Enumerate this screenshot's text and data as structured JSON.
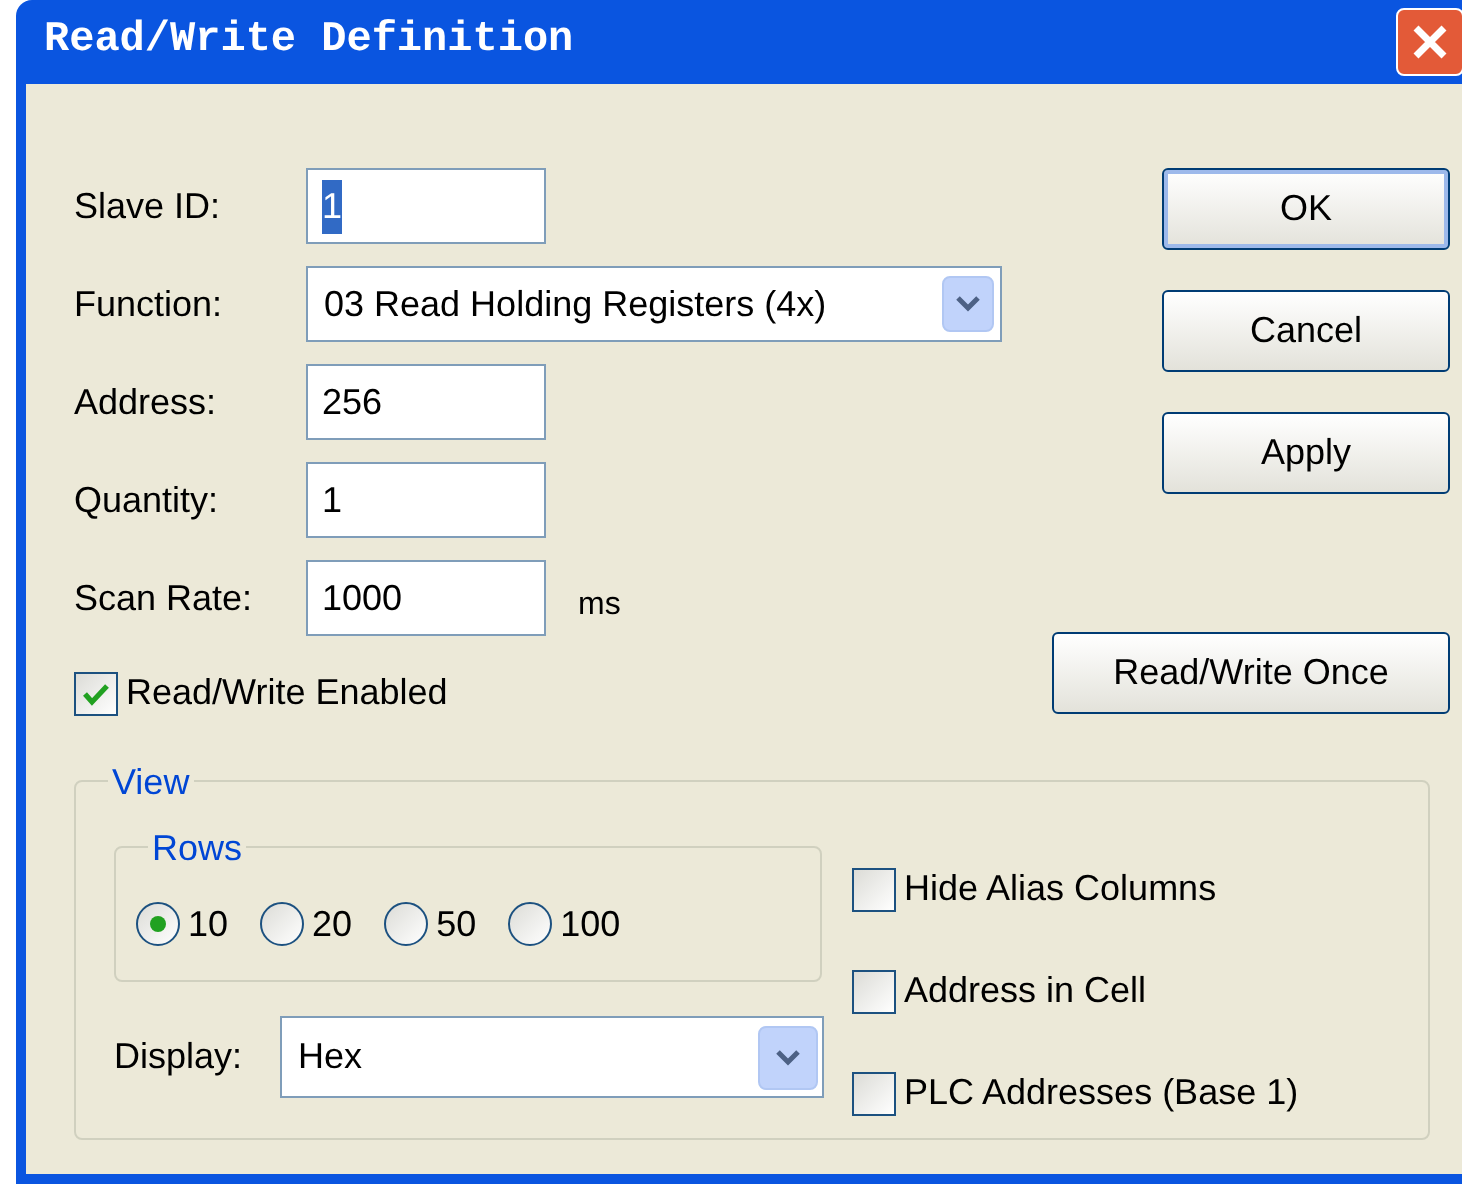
{
  "window": {
    "title": "Read/Write Definition"
  },
  "fields": [
    {
      "kind": "text",
      "label": "Slave ID:",
      "value": "1",
      "selected_text": true
    },
    {
      "kind": "select",
      "label": "Function:",
      "value": "03 Read Holding Registers (4x)"
    },
    {
      "kind": "text",
      "label": "Address:",
      "value": "256",
      "selected_text": false
    },
    {
      "kind": "text",
      "label": "Quantity:",
      "value": "1",
      "selected_text": false
    },
    {
      "kind": "text",
      "label": "Scan Rate:",
      "value": "1000",
      "unit": "ms",
      "selected_text": false
    }
  ],
  "enabled": {
    "label": "Read/Write Enabled",
    "checked": true
  },
  "buttons": [
    {
      "label": "OK",
      "default": true
    },
    {
      "label": "Cancel",
      "default": false
    },
    {
      "label": "Apply",
      "default": false
    }
  ],
  "once_button": {
    "label": "Read/Write Once"
  },
  "view": {
    "title": "View",
    "rows_title": "Rows",
    "rows": [
      {
        "label": "10",
        "selected": true
      },
      {
        "label": "20",
        "selected": false
      },
      {
        "label": "50",
        "selected": false
      },
      {
        "label": "100",
        "selected": false
      }
    ],
    "display": {
      "label": "Display:",
      "value": "Hex"
    },
    "options": [
      {
        "label": "Hide Alias Columns",
        "checked": false
      },
      {
        "label": "Address in Cell",
        "checked": false
      },
      {
        "label": "PLC Addresses (Base 1)",
        "checked": false
      }
    ]
  }
}
